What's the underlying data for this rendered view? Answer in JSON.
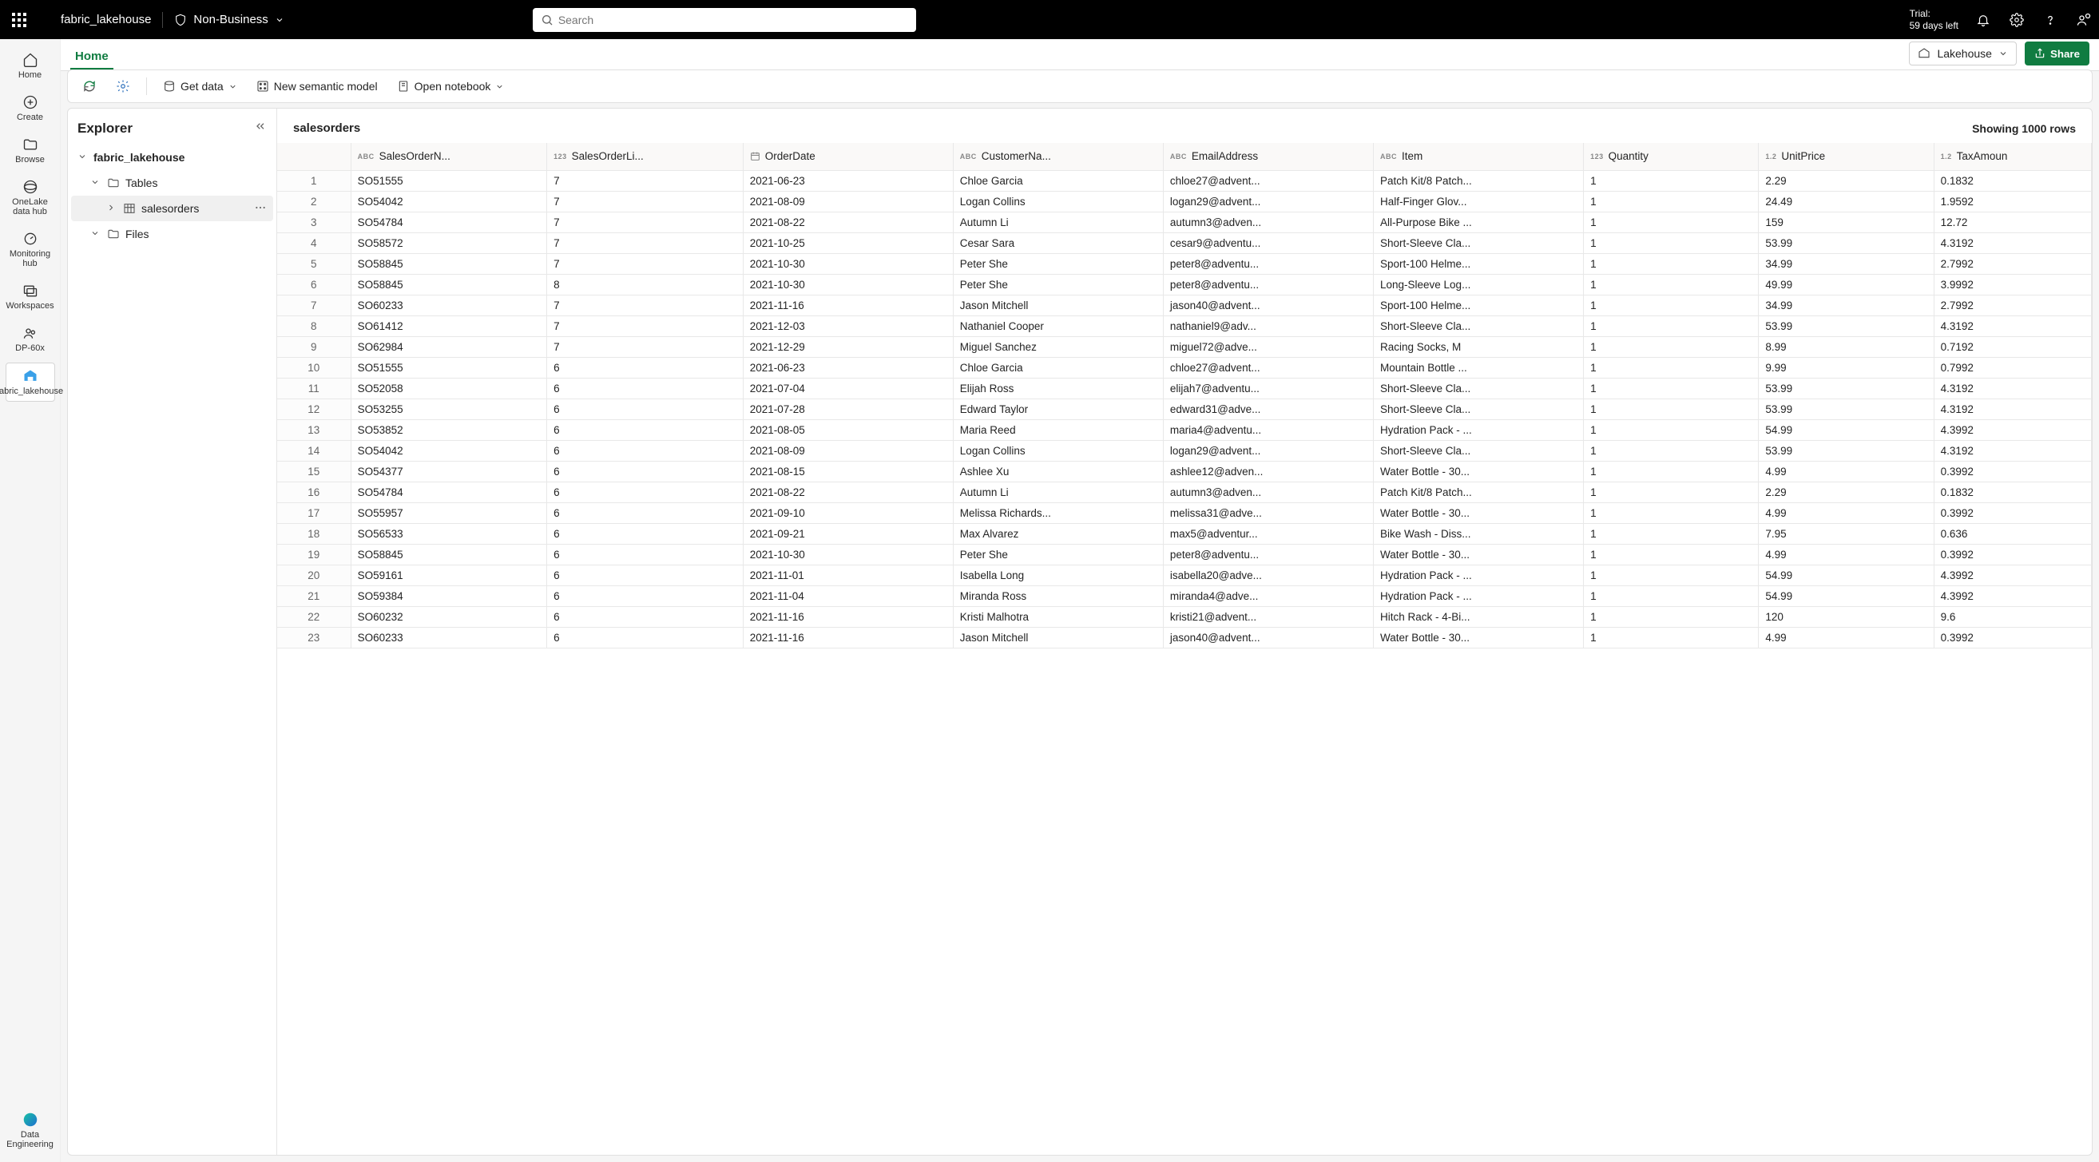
{
  "topbar": {
    "workspace_name": "fabric_lakehouse",
    "sensitivity_label": "Non-Business",
    "search_placeholder": "Search",
    "trial_label": "Trial:",
    "trial_remaining": "59 days left"
  },
  "secbar": {
    "tab_home": "Home",
    "lakehouse_label": "Lakehouse",
    "share_label": "Share"
  },
  "toolbar": {
    "get_data": "Get data",
    "new_semantic_model": "New semantic model",
    "open_notebook": "Open notebook"
  },
  "leftrail": {
    "items": [
      {
        "icon": "home",
        "label": "Home"
      },
      {
        "icon": "plus",
        "label": "Create"
      },
      {
        "icon": "folder",
        "label": "Browse"
      },
      {
        "icon": "onelake",
        "label": "OneLake data hub"
      },
      {
        "icon": "monitor",
        "label": "Monitoring hub"
      },
      {
        "icon": "workspaces",
        "label": "Workspaces"
      },
      {
        "icon": "group",
        "label": "DP-60x"
      },
      {
        "icon": "lakehouse",
        "label": "fabric_lakehouse"
      }
    ],
    "bottom": {
      "icon": "copilot",
      "label": "Data Engineering"
    }
  },
  "explorer": {
    "title": "Explorer",
    "root": "fabric_lakehouse",
    "tables_label": "Tables",
    "files_label": "Files",
    "selected_table": "salesorders"
  },
  "grid": {
    "title": "salesorders",
    "row_count_text": "Showing 1000 rows",
    "columns": [
      {
        "type": "ABC",
        "label": "SalesOrderN..."
      },
      {
        "type": "123",
        "label": "SalesOrderLi..."
      },
      {
        "type": "cal",
        "label": "OrderDate"
      },
      {
        "type": "ABC",
        "label": "CustomerNa..."
      },
      {
        "type": "ABC",
        "label": "EmailAddress"
      },
      {
        "type": "ABC",
        "label": "Item"
      },
      {
        "type": "123",
        "label": "Quantity"
      },
      {
        "type": "1.2",
        "label": "UnitPrice"
      },
      {
        "type": "1.2",
        "label": "TaxAmoun"
      }
    ],
    "rows": [
      [
        "SO51555",
        "7",
        "2021-06-23",
        "Chloe Garcia",
        "chloe27@advent...",
        "Patch Kit/8 Patch...",
        "1",
        "2.29",
        "0.1832"
      ],
      [
        "SO54042",
        "7",
        "2021-08-09",
        "Logan Collins",
        "logan29@advent...",
        "Half-Finger Glov...",
        "1",
        "24.49",
        "1.9592"
      ],
      [
        "SO54784",
        "7",
        "2021-08-22",
        "Autumn Li",
        "autumn3@adven...",
        "All-Purpose Bike ...",
        "1",
        "159",
        "12.72"
      ],
      [
        "SO58572",
        "7",
        "2021-10-25",
        "Cesar Sara",
        "cesar9@adventu...",
        "Short-Sleeve Cla...",
        "1",
        "53.99",
        "4.3192"
      ],
      [
        "SO58845",
        "7",
        "2021-10-30",
        "Peter She",
        "peter8@adventu...",
        "Sport-100 Helme...",
        "1",
        "34.99",
        "2.7992"
      ],
      [
        "SO58845",
        "8",
        "2021-10-30",
        "Peter She",
        "peter8@adventu...",
        "Long-Sleeve Log...",
        "1",
        "49.99",
        "3.9992"
      ],
      [
        "SO60233",
        "7",
        "2021-11-16",
        "Jason Mitchell",
        "jason40@advent...",
        "Sport-100 Helme...",
        "1",
        "34.99",
        "2.7992"
      ],
      [
        "SO61412",
        "7",
        "2021-12-03",
        "Nathaniel Cooper",
        "nathaniel9@adv...",
        "Short-Sleeve Cla...",
        "1",
        "53.99",
        "4.3192"
      ],
      [
        "SO62984",
        "7",
        "2021-12-29",
        "Miguel Sanchez",
        "miguel72@adve...",
        "Racing Socks, M",
        "1",
        "8.99",
        "0.7192"
      ],
      [
        "SO51555",
        "6",
        "2021-06-23",
        "Chloe Garcia",
        "chloe27@advent...",
        "Mountain Bottle ...",
        "1",
        "9.99",
        "0.7992"
      ],
      [
        "SO52058",
        "6",
        "2021-07-04",
        "Elijah Ross",
        "elijah7@adventu...",
        "Short-Sleeve Cla...",
        "1",
        "53.99",
        "4.3192"
      ],
      [
        "SO53255",
        "6",
        "2021-07-28",
        "Edward Taylor",
        "edward31@adve...",
        "Short-Sleeve Cla...",
        "1",
        "53.99",
        "4.3192"
      ],
      [
        "SO53852",
        "6",
        "2021-08-05",
        "Maria Reed",
        "maria4@adventu...",
        "Hydration Pack - ...",
        "1",
        "54.99",
        "4.3992"
      ],
      [
        "SO54042",
        "6",
        "2021-08-09",
        "Logan Collins",
        "logan29@advent...",
        "Short-Sleeve Cla...",
        "1",
        "53.99",
        "4.3192"
      ],
      [
        "SO54377",
        "6",
        "2021-08-15",
        "Ashlee Xu",
        "ashlee12@adven...",
        "Water Bottle - 30...",
        "1",
        "4.99",
        "0.3992"
      ],
      [
        "SO54784",
        "6",
        "2021-08-22",
        "Autumn Li",
        "autumn3@adven...",
        "Patch Kit/8 Patch...",
        "1",
        "2.29",
        "0.1832"
      ],
      [
        "SO55957",
        "6",
        "2021-09-10",
        "Melissa Richards...",
        "melissa31@adve...",
        "Water Bottle - 30...",
        "1",
        "4.99",
        "0.3992"
      ],
      [
        "SO56533",
        "6",
        "2021-09-21",
        "Max Alvarez",
        "max5@adventur...",
        "Bike Wash - Diss...",
        "1",
        "7.95",
        "0.636"
      ],
      [
        "SO58845",
        "6",
        "2021-10-30",
        "Peter She",
        "peter8@adventu...",
        "Water Bottle - 30...",
        "1",
        "4.99",
        "0.3992"
      ],
      [
        "SO59161",
        "6",
        "2021-11-01",
        "Isabella Long",
        "isabella20@adve...",
        "Hydration Pack - ...",
        "1",
        "54.99",
        "4.3992"
      ],
      [
        "SO59384",
        "6",
        "2021-11-04",
        "Miranda Ross",
        "miranda4@adve...",
        "Hydration Pack - ...",
        "1",
        "54.99",
        "4.3992"
      ],
      [
        "SO60232",
        "6",
        "2021-11-16",
        "Kristi Malhotra",
        "kristi21@advent...",
        "Hitch Rack - 4-Bi...",
        "1",
        "120",
        "9.6"
      ],
      [
        "SO60233",
        "6",
        "2021-11-16",
        "Jason Mitchell",
        "jason40@advent...",
        "Water Bottle - 30...",
        "1",
        "4.99",
        "0.3992"
      ]
    ]
  }
}
